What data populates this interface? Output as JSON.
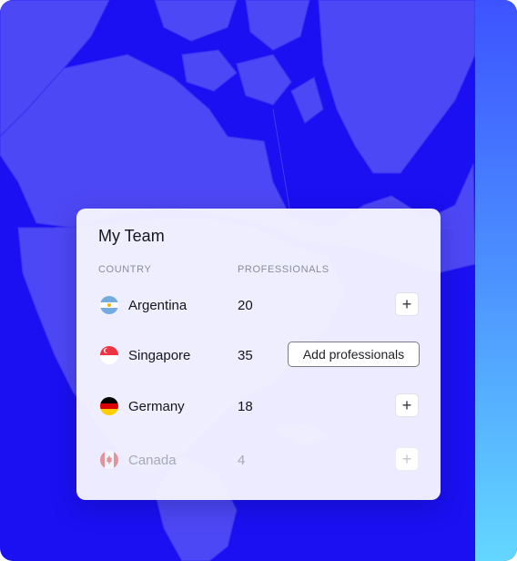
{
  "card": {
    "title": "My Team",
    "columns": {
      "country": "COUNTRY",
      "professionals": "PROFESSIONALS"
    },
    "rows": [
      {
        "country": "Argentina",
        "count": "20",
        "action": "+",
        "flag": "argentina-flag-icon"
      },
      {
        "country": "Singapore",
        "count": "35",
        "action": "Add professionals",
        "flag": "singapore-flag-icon"
      },
      {
        "country": "Germany",
        "count": "18",
        "action": "+",
        "flag": "germany-flag-icon"
      },
      {
        "country": "Canada",
        "count": "4",
        "action": "+",
        "flag": "canada-flag-icon",
        "disabled": true
      }
    ]
  },
  "colors": {
    "background": "#1a10f2",
    "map_land": "#4a45f6",
    "card": "#f5f5ff"
  }
}
